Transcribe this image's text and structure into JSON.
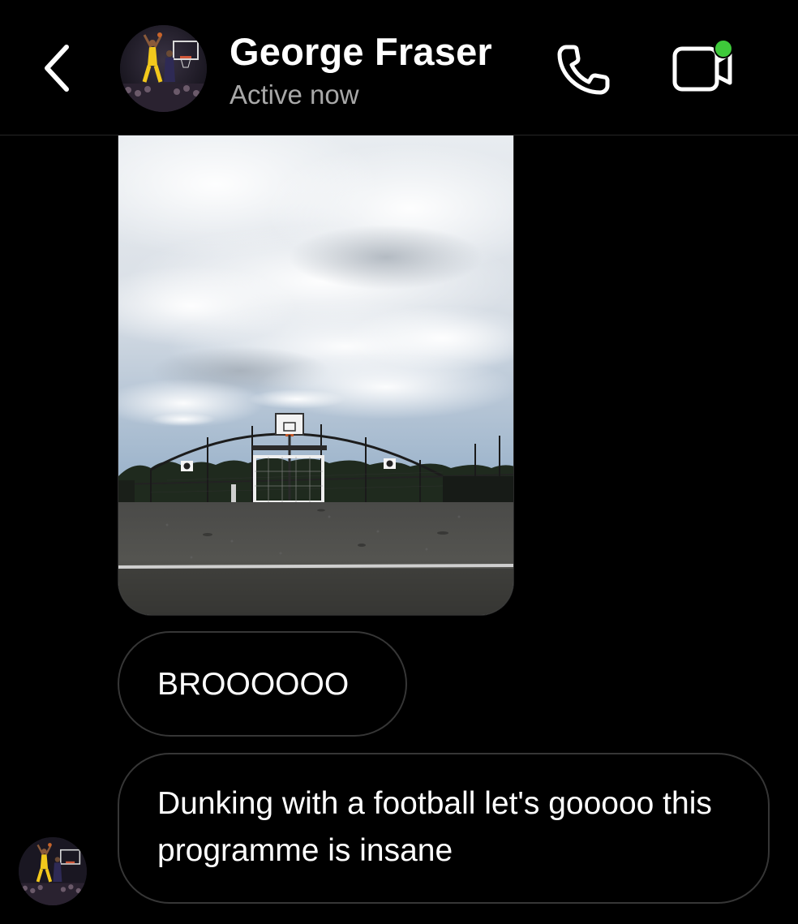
{
  "header": {
    "contact_name": "George Fraser",
    "status": "Active now",
    "back_icon": "chevron-left-icon",
    "call_icon": "phone-icon",
    "video_icon": "video-camera-icon",
    "online_color": "#3ec93a"
  },
  "messages": [
    {
      "type": "photo",
      "description_icon": "photo-attachment"
    },
    {
      "type": "text",
      "text": "BROOOOOO"
    },
    {
      "type": "text",
      "text": "Dunking with a football let's gooooo this programme is insane"
    }
  ],
  "colors": {
    "background": "#000000",
    "bubble_border": "#363636",
    "secondary_text": "#a8a8a8"
  }
}
